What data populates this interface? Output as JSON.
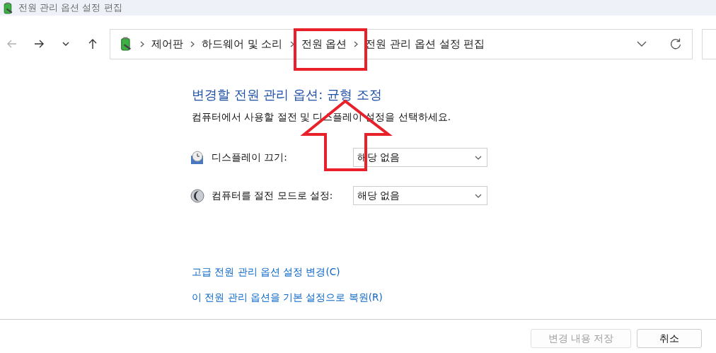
{
  "window": {
    "title": "전원 관리 옵션 설정 편집"
  },
  "nav_buttons": [
    {
      "kind": "back",
      "disabled": true
    },
    {
      "kind": "forward",
      "disabled": false
    },
    {
      "kind": "recent",
      "disabled": false
    },
    {
      "kind": "up",
      "disabled": false
    }
  ],
  "address_bar": {
    "breadcrumbs": [
      {
        "label": "제어판",
        "highlighted": false
      },
      {
        "label": "하드웨어 및 소리",
        "highlighted": false
      },
      {
        "label": "전원 옵션",
        "highlighted": true
      },
      {
        "label": "전원 관리 옵션 설정 편집",
        "highlighted": false
      }
    ]
  },
  "content": {
    "heading": "변경할 전원 관리 옵션: 균형 조정",
    "heading_arrow": true,
    "description": "컴퓨터에서 사용할 절전 및 디스플레이 설정을 선택하세요.",
    "settings": [
      {
        "kind": "display",
        "label": "디스플레이 끄기:",
        "value": "해당 없음"
      },
      {
        "kind": "sleep",
        "label": "컴퓨터를 절전 모드로 설정:",
        "value": "해당 없음"
      }
    ],
    "links": [
      "고급 전원 관리 옵션 설정 변경(C)",
      "이 전원 관리 옵션을 기본 설정으로 복원(R)"
    ]
  },
  "buttons": [
    {
      "label": "변경 내용 저장",
      "disabled": true
    },
    {
      "label": "취소",
      "disabled": false
    }
  ]
}
